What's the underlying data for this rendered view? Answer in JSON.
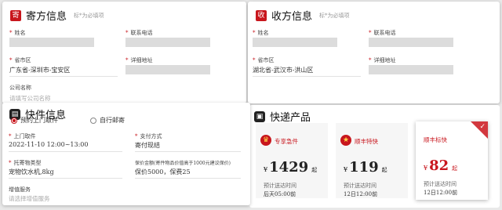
{
  "sender": {
    "badge": "寄",
    "title": "寄方信息",
    "note": "标*为必填项",
    "name_label": "姓名",
    "phone_label": "联系电话",
    "region_label": "省市区",
    "region_value": "广东省-深圳市-宝安区",
    "address_label": "详细地址",
    "company_label": "公司名称",
    "company_placeholder": "请填写公司名称"
  },
  "receiver": {
    "badge": "收",
    "title": "收方信息",
    "note": "标*为必填项",
    "name_label": "姓名",
    "phone_label": "联系电话",
    "region_label": "省市区",
    "region_value": "湖北省-武汉市-洪山区",
    "address_label": "详细地址"
  },
  "shipment": {
    "title": "快件信息",
    "pickup_option": "预约上门取件",
    "dropoff_option": "自行邮寄",
    "pickup_time_label": "上门取件",
    "pickup_time_value": "2022-11-10  12:00~13:00",
    "payment_label": "支付方式",
    "payment_value": "寄付现结",
    "item_label": "托寄物类型",
    "item_value": "宠物饮水机,8kg",
    "insure_label": "保价金额(寄件物品价值高于1000元建议保价)",
    "insure_value": "保价5000，保费25",
    "extra_label": "增值服务",
    "extra_placeholder": "请选择增值服务"
  },
  "products": {
    "title": "快递产品",
    "items": [
      {
        "name": "专享急件",
        "currency": "¥",
        "price": "1429",
        "unit": "起",
        "eta_label": "预计送达时间",
        "eta": "后天05:00前",
        "selected": false
      },
      {
        "name": "顺丰特快",
        "currency": "¥",
        "price": "119",
        "unit": "起",
        "eta_label": "预计送达时间",
        "eta": "12日12:00前",
        "selected": false
      },
      {
        "name": "顺丰标快",
        "currency": "¥",
        "price": "82",
        "unit": "起",
        "eta_label": "预计送达时间",
        "eta": "12日12:00前",
        "selected": true
      }
    ]
  },
  "colors": {
    "accent": "#c8161d"
  }
}
